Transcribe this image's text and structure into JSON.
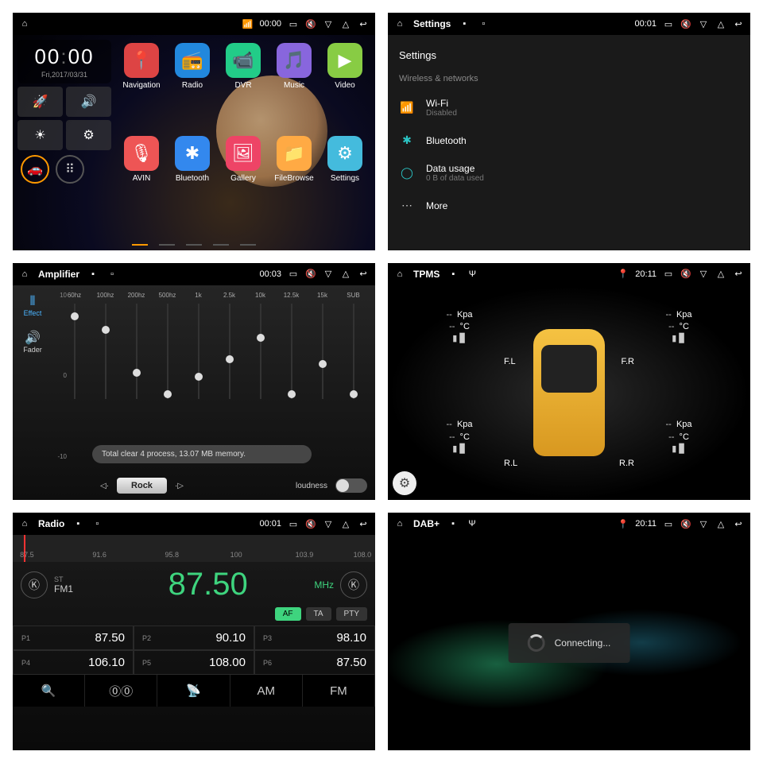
{
  "p1": {
    "time": "00:00",
    "statusbar": {
      "hh": "00",
      "mm": "00",
      "date": "Fri,2017/03/31"
    },
    "apps": [
      {
        "label": "Navigation",
        "bg": "#d44"
      },
      {
        "label": "Radio",
        "bg": "#28d"
      },
      {
        "label": "DVR",
        "bg": "#2c8"
      },
      {
        "label": "Music",
        "bg": "#86d"
      },
      {
        "label": "Video",
        "bg": "#8c4"
      },
      {
        "label": "AVIN",
        "bg": "#e55"
      },
      {
        "label": "Bluetooth",
        "bg": "#38e"
      },
      {
        "label": "Gallery",
        "bg": "#e46"
      },
      {
        "label": "FileBrowse",
        "bg": "#fa4"
      },
      {
        "label": "Settings",
        "bg": "#4bd"
      }
    ]
  },
  "p2": {
    "title": "Settings",
    "time": "00:01",
    "header": "Settings",
    "section": "Wireless & networks",
    "items": [
      {
        "icon": "wifi",
        "t1": "Wi-Fi",
        "t2": "Disabled",
        "color": "#2bc4c4"
      },
      {
        "icon": "bt",
        "t1": "Bluetooth",
        "t2": "",
        "color": "#2bc4c4"
      },
      {
        "icon": "data",
        "t1": "Data usage",
        "t2": "0 B of data used",
        "color": "#2bc4c4"
      },
      {
        "icon": "more",
        "t1": "More",
        "t2": "",
        "color": "#ccc"
      }
    ]
  },
  "p3": {
    "title": "Amplifier",
    "time": "00:03",
    "side": [
      {
        "l": "Effect",
        "act": true
      },
      {
        "l": "Fader",
        "act": false
      }
    ],
    "bands": [
      "60hz",
      "100hz",
      "200hz",
      "500hz",
      "1k",
      "2.5k",
      "10k",
      "12.5k",
      "15k",
      "SUB"
    ],
    "values": [
      8,
      5,
      -5,
      -10,
      -6,
      -2,
      3,
      -10,
      -3,
      -10
    ],
    "scale": [
      "10",
      "0",
      "-10"
    ],
    "subscale": [
      "8",
      "10"
    ],
    "toast": "Total clear 4 process, 13.07 MB memory.",
    "preset": "Rock",
    "loudness": "loudness"
  },
  "p4": {
    "title": "TPMS",
    "time": "20:11",
    "tires": {
      "fl": {
        "p": "--",
        "pu": "Kpa",
        "t": "--",
        "tu": "°C",
        "tag": "F.L"
      },
      "fr": {
        "p": "--",
        "pu": "Kpa",
        "t": "--",
        "tu": "°C",
        "tag": "F.R"
      },
      "rl": {
        "p": "--",
        "pu": "Kpa",
        "t": "--",
        "tu": "°C",
        "tag": "R.L"
      },
      "rr": {
        "p": "--",
        "pu": "Kpa",
        "t": "--",
        "tu": "°C",
        "tag": "R.R"
      }
    }
  },
  "p5": {
    "title": "Radio",
    "time": "00:01",
    "dial": [
      "87.5",
      "91.6",
      "95.8",
      "100",
      "103.9",
      "108.0"
    ],
    "st": "ST",
    "band": "FM1",
    "freq": "87.50",
    "unit": "MHz",
    "opts": [
      {
        "l": "AF",
        "on": true
      },
      {
        "l": "TA",
        "on": false
      },
      {
        "l": "PTY",
        "on": false
      }
    ],
    "presets": [
      {
        "n": "P1",
        "v": "87.50"
      },
      {
        "n": "P2",
        "v": "90.10"
      },
      {
        "n": "P3",
        "v": "98.10"
      },
      {
        "n": "P4",
        "v": "106.10"
      },
      {
        "n": "P5",
        "v": "108.00"
      },
      {
        "n": "P6",
        "v": "87.50"
      }
    ],
    "foot": [
      "🔍",
      "⓪⓪",
      "📡",
      "AM",
      "FM"
    ]
  },
  "p6": {
    "title": "DAB+",
    "time": "20:11",
    "msg": "Connecting..."
  }
}
